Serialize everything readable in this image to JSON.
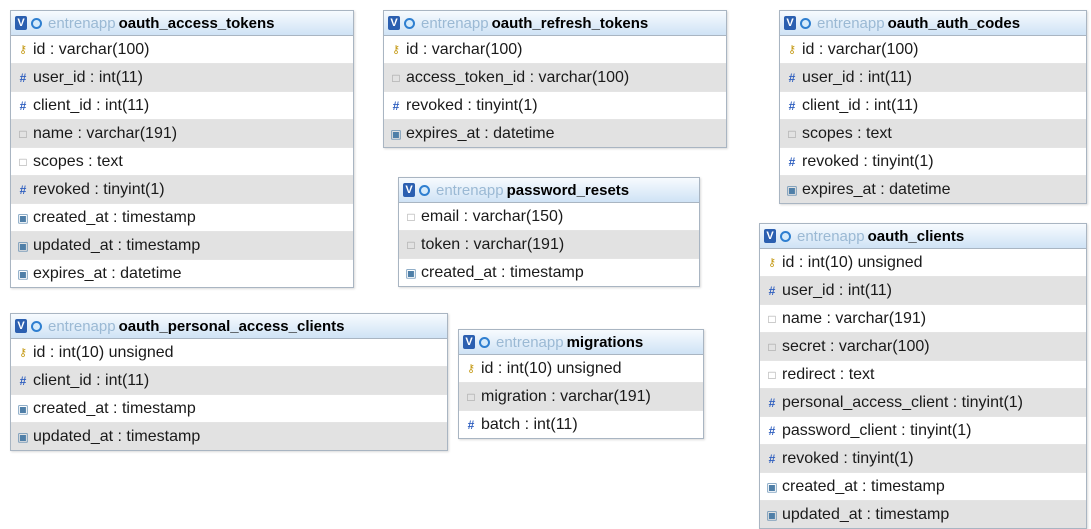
{
  "tables": [
    {
      "db": "entrenapp",
      "name": "oauth_access_tokens",
      "columns": [
        {
          "label": "id : varchar(100)",
          "icon": "key-icon"
        },
        {
          "label": "user_id : int(11)",
          "icon": "numeric-icon"
        },
        {
          "label": "client_id : int(11)",
          "icon": "numeric-icon"
        },
        {
          "label": "name : varchar(191)",
          "icon": "text-icon"
        },
        {
          "label": "scopes : text",
          "icon": "text-icon"
        },
        {
          "label": "revoked : tinyint(1)",
          "icon": "numeric-icon"
        },
        {
          "label": "created_at : timestamp",
          "icon": "date-icon"
        },
        {
          "label": "updated_at : timestamp",
          "icon": "date-icon"
        },
        {
          "label": "expires_at : datetime",
          "icon": "date-icon"
        }
      ]
    },
    {
      "db": "entrenapp",
      "name": "oauth_refresh_tokens",
      "columns": [
        {
          "label": "id : varchar(100)",
          "icon": "key-icon"
        },
        {
          "label": "access_token_id : varchar(100)",
          "icon": "text-icon"
        },
        {
          "label": "revoked : tinyint(1)",
          "icon": "numeric-icon"
        },
        {
          "label": "expires_at : datetime",
          "icon": "date-icon"
        }
      ]
    },
    {
      "db": "entrenapp",
      "name": "oauth_auth_codes",
      "columns": [
        {
          "label": "id : varchar(100)",
          "icon": "key-icon"
        },
        {
          "label": "user_id : int(11)",
          "icon": "numeric-icon"
        },
        {
          "label": "client_id : int(11)",
          "icon": "numeric-icon"
        },
        {
          "label": "scopes : text",
          "icon": "text-icon"
        },
        {
          "label": "revoked : tinyint(1)",
          "icon": "numeric-icon"
        },
        {
          "label": "expires_at : datetime",
          "icon": "date-icon"
        }
      ]
    },
    {
      "db": "entrenapp",
      "name": "password_resets",
      "columns": [
        {
          "label": "email : varchar(150)",
          "icon": "text-icon"
        },
        {
          "label": "token : varchar(191)",
          "icon": "text-icon"
        },
        {
          "label": "created_at : timestamp",
          "icon": "date-icon"
        }
      ]
    },
    {
      "db": "entrenapp",
      "name": "oauth_clients",
      "columns": [
        {
          "label": "id : int(10) unsigned",
          "icon": "key-icon"
        },
        {
          "label": "user_id : int(11)",
          "icon": "numeric-icon"
        },
        {
          "label": "name : varchar(191)",
          "icon": "text-icon"
        },
        {
          "label": "secret : varchar(100)",
          "icon": "text-icon"
        },
        {
          "label": "redirect : text",
          "icon": "text-icon"
        },
        {
          "label": "personal_access_client : tinyint(1)",
          "icon": "numeric-icon"
        },
        {
          "label": "password_client : tinyint(1)",
          "icon": "numeric-icon"
        },
        {
          "label": "revoked : tinyint(1)",
          "icon": "numeric-icon"
        },
        {
          "label": "created_at : timestamp",
          "icon": "date-icon"
        },
        {
          "label": "updated_at : timestamp",
          "icon": "date-icon"
        }
      ]
    },
    {
      "db": "entrenapp",
      "name": "oauth_personal_access_clients",
      "columns": [
        {
          "label": "id : int(10) unsigned",
          "icon": "key-icon"
        },
        {
          "label": "client_id : int(11)",
          "icon": "numeric-icon"
        },
        {
          "label": "created_at : timestamp",
          "icon": "date-icon"
        },
        {
          "label": "updated_at : timestamp",
          "icon": "date-icon"
        }
      ]
    },
    {
      "db": "entrenapp",
      "name": "migrations",
      "columns": [
        {
          "label": "id : int(10) unsigned",
          "icon": "key-icon"
        },
        {
          "label": "migration : varchar(191)",
          "icon": "text-icon"
        },
        {
          "label": "batch : int(11)",
          "icon": "numeric-icon"
        }
      ]
    }
  ],
  "toggle_glyph": "V",
  "colors": {
    "header_top": "#f7fbfe",
    "header_bottom": "#cfe3f5",
    "zebra": "#e2e2e2",
    "db_name": "#9bb9d4",
    "border": "#a9b5c2"
  }
}
